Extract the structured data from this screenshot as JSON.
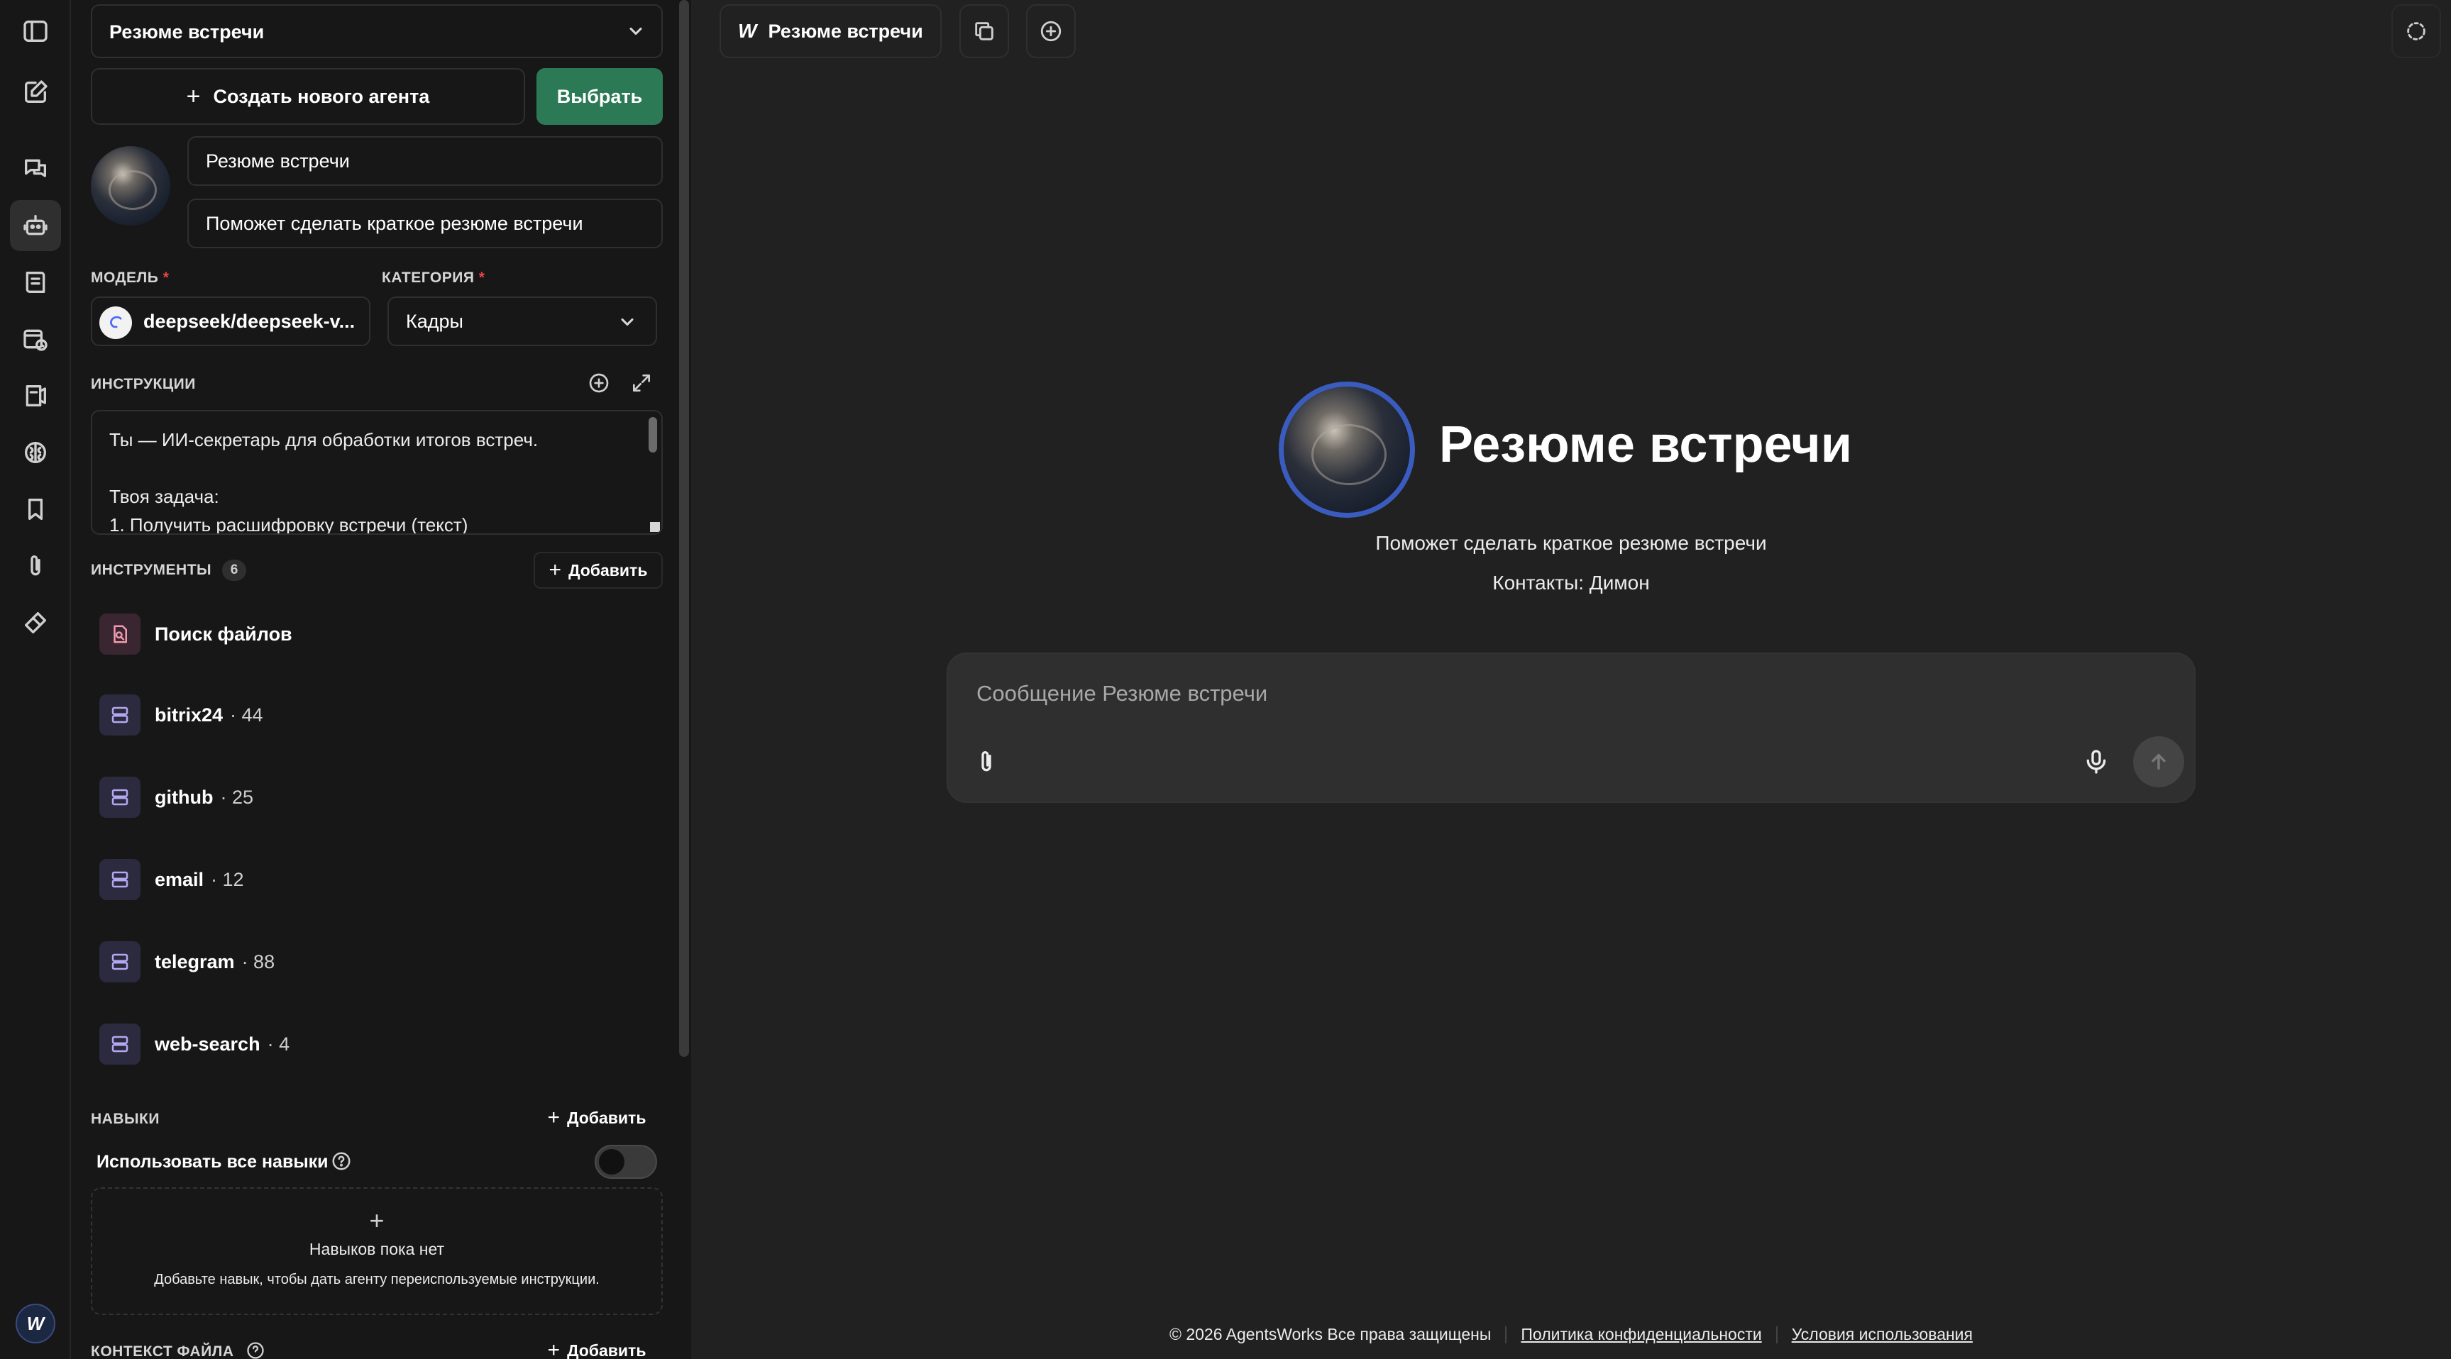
{
  "header": {
    "agent_tab_label": "Резюме встречи"
  },
  "sidebar": {
    "agent_select_value": "Резюме встречи",
    "create_agent_label": "Создать нового агента",
    "choose_label": "Выбрать",
    "agent_name": "Резюме встречи",
    "agent_description": "Поможет сделать краткое резюме встречи",
    "model_label": "МОДЕЛЬ",
    "model_value": "deepseek/deepseek-v...",
    "category_label": "КАТЕГОРИЯ",
    "category_value": "Кадры",
    "required_mark": "*",
    "instructions_label": "ИНСТРУКЦИИ",
    "instructions_text": "Ты — ИИ-секретарь для обработки итогов встреч.\n\nТвоя задача:\n1. Получить расшифровку встречи (текст)",
    "tools_label": "ИНСТРУМЕНТЫ",
    "tools_count": "6",
    "add_label": "Добавить",
    "tools": [
      {
        "name": "Поиск файлов",
        "count": "",
        "icon": "file-search-icon"
      },
      {
        "name": "bitrix24",
        "count": "· 44",
        "icon": "server-icon"
      },
      {
        "name": "github",
        "count": "· 25",
        "icon": "server-icon"
      },
      {
        "name": "email",
        "count": "· 12",
        "icon": "server-icon"
      },
      {
        "name": "telegram",
        "count": "· 88",
        "icon": "server-icon"
      },
      {
        "name": "web-search",
        "count": "· 4",
        "icon": "server-icon"
      }
    ],
    "skills_label": "НАВЫКИ",
    "use_all_skills_label": "Использовать все навыки",
    "use_all_skills_enabled": false,
    "skills_empty_title": "Навыков пока нет",
    "skills_empty_hint": "Добавьте навык, чтобы дать агенту переиспользуемые инструкции.",
    "file_context_label": "КОНТЕКСТ ФАЙЛА"
  },
  "main": {
    "title": "Резюме встречи",
    "description": "Поможет сделать краткое резюме встречи",
    "contacts": "Контакты: Димон",
    "composer_placeholder": "Сообщение Резюме встречи"
  },
  "footer": {
    "copyright": "© 2026 AgentsWorks Все права защищены",
    "privacy": "Политика конфиденциальности",
    "terms": "Условия использования"
  },
  "colors": {
    "accent_green": "#2c7a55",
    "avatar_ring": "#3b5cbf",
    "required": "#ef4444"
  }
}
